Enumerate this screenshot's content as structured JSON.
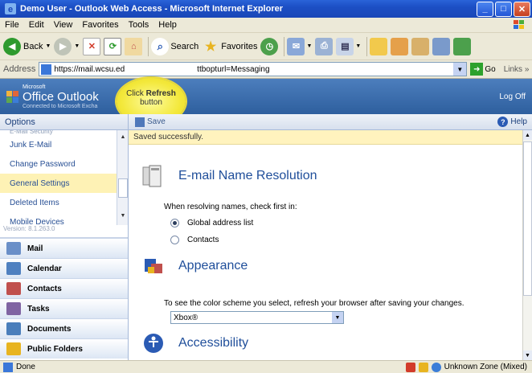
{
  "window": {
    "title": "Demo User - Outlook Web Access - Microsoft Internet Explorer",
    "minimize_label": "_",
    "maximize_label": "□",
    "close_label": "✕"
  },
  "menu": [
    "File",
    "Edit",
    "View",
    "Favorites",
    "Tools",
    "Help"
  ],
  "toolbar": {
    "back_label": "Back",
    "search_label": "Search",
    "favorites_label": "Favorites"
  },
  "address": {
    "label": "Address",
    "url": "https://mail.wcsu.ed",
    "url_tail": "ttbopturl=Messaging",
    "go_label": "Go",
    "links_label": "Links"
  },
  "owa": {
    "brand_small": "Microsoft",
    "brand": "Office Outlook",
    "brand_sub": "Connected to Microsoft Excha",
    "logoff": "Log Off"
  },
  "callout": {
    "prefix": "Click ",
    "bold": "Refresh",
    "suffix": "button"
  },
  "options": {
    "header": "Options",
    "items": [
      {
        "label": "E-Mail Security",
        "state": "cut"
      },
      {
        "label": "Junk E-Mail",
        "state": "normal"
      },
      {
        "label": "Change Password",
        "state": "normal"
      },
      {
        "label": "General Settings",
        "state": "selected"
      },
      {
        "label": "Deleted Items",
        "state": "normal"
      },
      {
        "label": "Mobile Devices",
        "state": "normal"
      }
    ],
    "version": "Version: 8.1.263.0"
  },
  "modules": [
    {
      "label": "Mail",
      "icon": "mail-icon",
      "color": "#6A8FC8"
    },
    {
      "label": "Calendar",
      "icon": "calendar-icon",
      "color": "#4F80C0"
    },
    {
      "label": "Contacts",
      "icon": "contacts-icon",
      "color": "#C0504D"
    },
    {
      "label": "Tasks",
      "icon": "tasks-icon",
      "color": "#8064A2"
    },
    {
      "label": "Documents",
      "icon": "documents-icon",
      "color": "#4A7EBB"
    },
    {
      "label": "Public Folders",
      "icon": "public-folders-icon",
      "color": "#E8B420"
    }
  ],
  "main": {
    "save_label": "Save",
    "help_label": "Help",
    "saved_message": "Saved successfully.",
    "email_resolution": {
      "heading": "E-mail Name Resolution",
      "prompt": "When resolving names, check first in:",
      "options": [
        {
          "label": "Global address list",
          "checked": true
        },
        {
          "label": "Contacts",
          "checked": false
        }
      ]
    },
    "appearance": {
      "heading": "Appearance",
      "text": "To see the color scheme you select, refresh your browser after saving your changes.",
      "scheme_value": "Xbox®"
    },
    "accessibility": {
      "heading": "Accessibility"
    }
  },
  "status": {
    "done": "Done",
    "zone": "Unknown Zone (Mixed)"
  }
}
